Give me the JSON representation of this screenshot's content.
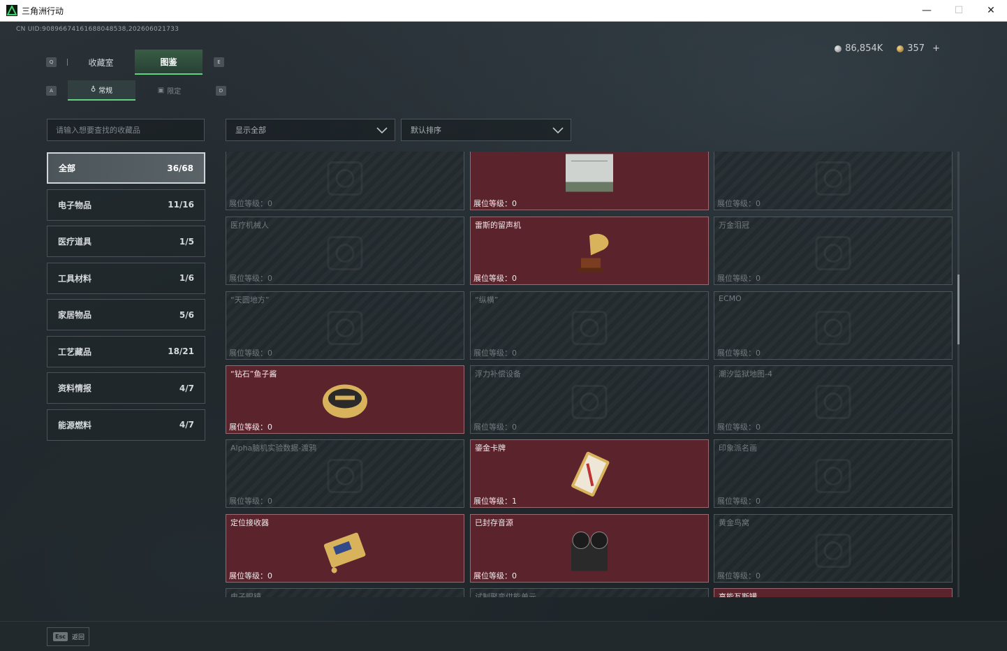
{
  "window": {
    "title": "三角洲行动",
    "minimize": "—",
    "maximize": "☐",
    "close": "✕"
  },
  "uid": "CN UID:9089667416168804853​8,202606021733",
  "currency": {
    "silver": "86,854K",
    "gold": "357",
    "plus": "+"
  },
  "keys": {
    "left_main": "Q",
    "right_main": "E",
    "left_sub": "A",
    "right_sub": "D"
  },
  "tabs": {
    "collection_room": "收藏室",
    "codex": "图鉴"
  },
  "subtabs": {
    "normal": "常规",
    "limited": "限定"
  },
  "search": {
    "placeholder": "请输入想要查找的收藏品"
  },
  "filters": {
    "show": "显示全部",
    "sort": "默认排序"
  },
  "categories": [
    {
      "label": "全部",
      "count": "36/68"
    },
    {
      "label": "电子物品",
      "count": "11/16"
    },
    {
      "label": "医疗道具",
      "count": "1/5"
    },
    {
      "label": "工具材料",
      "count": "1/6"
    },
    {
      "label": "家居物品",
      "count": "5/6"
    },
    {
      "label": "工艺藏品",
      "count": "18/21"
    },
    {
      "label": "资料情报",
      "count": "4/7"
    },
    {
      "label": "能源燃料",
      "count": "4/7"
    }
  ],
  "level_prefix": "展位等级：",
  "cards": [
    {
      "name": "",
      "level": "0",
      "owned": false,
      "icon": "robot-arm-icon"
    },
    {
      "name": "",
      "level": "0",
      "owned": true,
      "icon": "server-case-icon"
    },
    {
      "name": "",
      "level": "0",
      "owned": false,
      "icon": "building-model-icon"
    },
    {
      "name": "医疗机械人",
      "level": "0",
      "owned": false,
      "icon": "medical-robot-icon"
    },
    {
      "name": "雷斯的留声机",
      "level": "0",
      "owned": true,
      "icon": "gramophone-icon"
    },
    {
      "name": "万金泪冠",
      "level": "0",
      "owned": false,
      "icon": "crown-icon"
    },
    {
      "name": "“天圆地方”",
      "level": "0",
      "owned": false,
      "icon": "globe-icon"
    },
    {
      "name": "“纵横”",
      "level": "0",
      "owned": false,
      "icon": "board-game-icon"
    },
    {
      "name": "ECMO",
      "level": "0",
      "owned": false,
      "icon": "ecmo-machine-icon"
    },
    {
      "name": "“钻石”鱼子酱",
      "level": "0",
      "owned": true,
      "icon": "caviar-tin-icon"
    },
    {
      "name": "浮力补偿设备",
      "level": "0",
      "owned": false,
      "icon": "bcd-vest-icon"
    },
    {
      "name": "潮汐监狱地图-4",
      "level": "0",
      "owned": false,
      "icon": "map-icon"
    },
    {
      "name": "Alpha脑机实验数据-渡鸦",
      "level": "0",
      "owned": false,
      "icon": "data-drive-icon"
    },
    {
      "name": "鎏金卡牌",
      "level": "1",
      "owned": true,
      "icon": "gold-card-icon"
    },
    {
      "name": "印象派名画",
      "level": "0",
      "owned": false,
      "icon": "painting-icon"
    },
    {
      "name": "定位接收器",
      "level": "0",
      "owned": true,
      "icon": "gps-receiver-icon"
    },
    {
      "name": "已封存音源",
      "level": "0",
      "owned": true,
      "icon": "reel-recorder-icon"
    },
    {
      "name": "黄金鸟窝",
      "level": "0",
      "owned": false,
      "icon": "golden-nest-icon"
    },
    {
      "name": "电子眼镜",
      "level": "",
      "owned": false,
      "icon": "glasses-icon"
    },
    {
      "name": "试制聚变供能单元",
      "level": "",
      "owned": false,
      "icon": "fusion-cell-icon"
    },
    {
      "name": "高能瓦斯罐",
      "level": "",
      "owned": true,
      "icon": "gas-tank-icon"
    }
  ],
  "footer": {
    "esc_key": "Esc",
    "esc_label": "返回"
  }
}
